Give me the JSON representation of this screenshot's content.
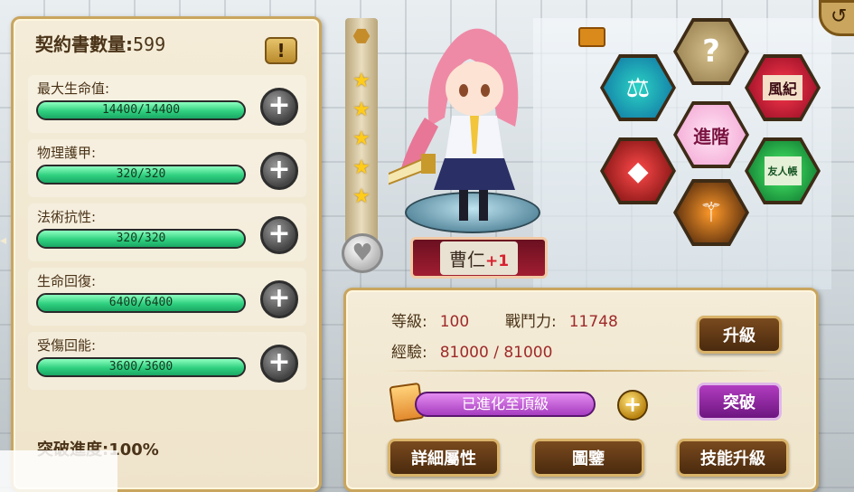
{
  "left_panel": {
    "contracts_label": "契約書數量:",
    "contracts_value": "599",
    "warn_symbol": "!",
    "stats": [
      {
        "label": "最大生命值:",
        "value": "14400/14400",
        "fill": 1.0
      },
      {
        "label": "物理護甲:",
        "value": "320/320",
        "fill": 1.0
      },
      {
        "label": "法術抗性:",
        "value": "320/320",
        "fill": 1.0
      },
      {
        "label": "生命回復:",
        "value": "6400/6400",
        "fill": 1.0
      },
      {
        "label": "受傷回能:",
        "value": "3600/3600",
        "fill": 1.0
      }
    ],
    "plus_symbol": "+",
    "breakthrough_progress": "突破進度:100%"
  },
  "star_column": {
    "star_count": 5,
    "star_symbol": "★"
  },
  "character": {
    "name": "曹仁",
    "rank": "+1"
  },
  "hex_menu": {
    "help": "?",
    "fengji": "風紀",
    "advance": "進階",
    "book": "友人帳"
  },
  "info": {
    "level_label": "等級:",
    "level_value": "100",
    "power_label": "戰鬥力:",
    "power_value": "11748",
    "exp_label": "經驗:",
    "exp_value": "81000 / 81000",
    "evolve_status": "已進化至頂級",
    "buttons": {
      "upgrade": "升級",
      "breakthrough": "突破",
      "details": "詳細屬性",
      "codex": "圖鑒",
      "skill_upgrade": "技能升級"
    }
  },
  "colors": {
    "panel_border": "#c9a55e",
    "hp_bar": "#2fd07f",
    "value_red": "#9e2a2a",
    "purple_button": "#a63dc0"
  }
}
